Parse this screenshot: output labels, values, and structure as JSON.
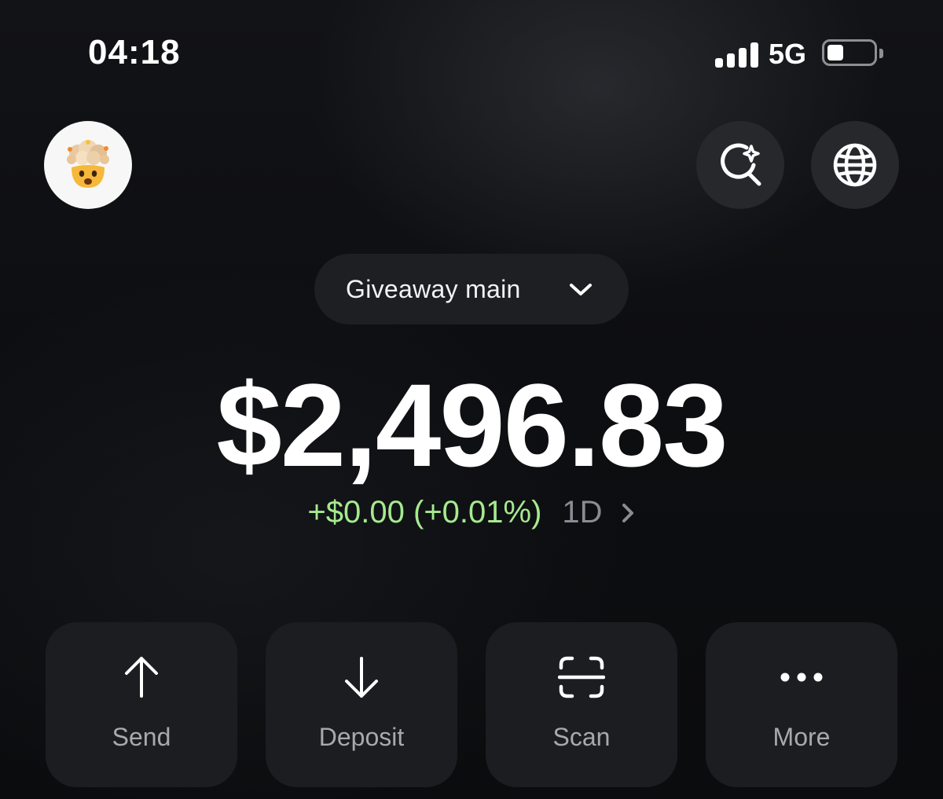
{
  "status_bar": {
    "time": "04:18",
    "network": "5G",
    "signal_bars": 4,
    "battery_level": 0.35
  },
  "header": {
    "avatar_icon": "exploding-head-emoji-icon",
    "search_button_icon": "sparkle-search-icon",
    "globe_button_icon": "globe-icon"
  },
  "wallet": {
    "name": "Giveaway main"
  },
  "balance": {
    "amount": "$2,496.83",
    "change": "+$0.00 (+0.01%)",
    "period": "1D"
  },
  "actions": [
    {
      "label": "Send",
      "icon": "arrow-up-icon"
    },
    {
      "label": "Deposit",
      "icon": "arrow-down-icon"
    },
    {
      "label": "Scan",
      "icon": "scan-icon"
    },
    {
      "label": "More",
      "icon": "more-dots-icon"
    }
  ],
  "colors": {
    "background": "#0d0e10",
    "positive_change": "#a6ea8f",
    "button_surface": "#1b1d20",
    "pill_surface": "#1d1f22"
  }
}
